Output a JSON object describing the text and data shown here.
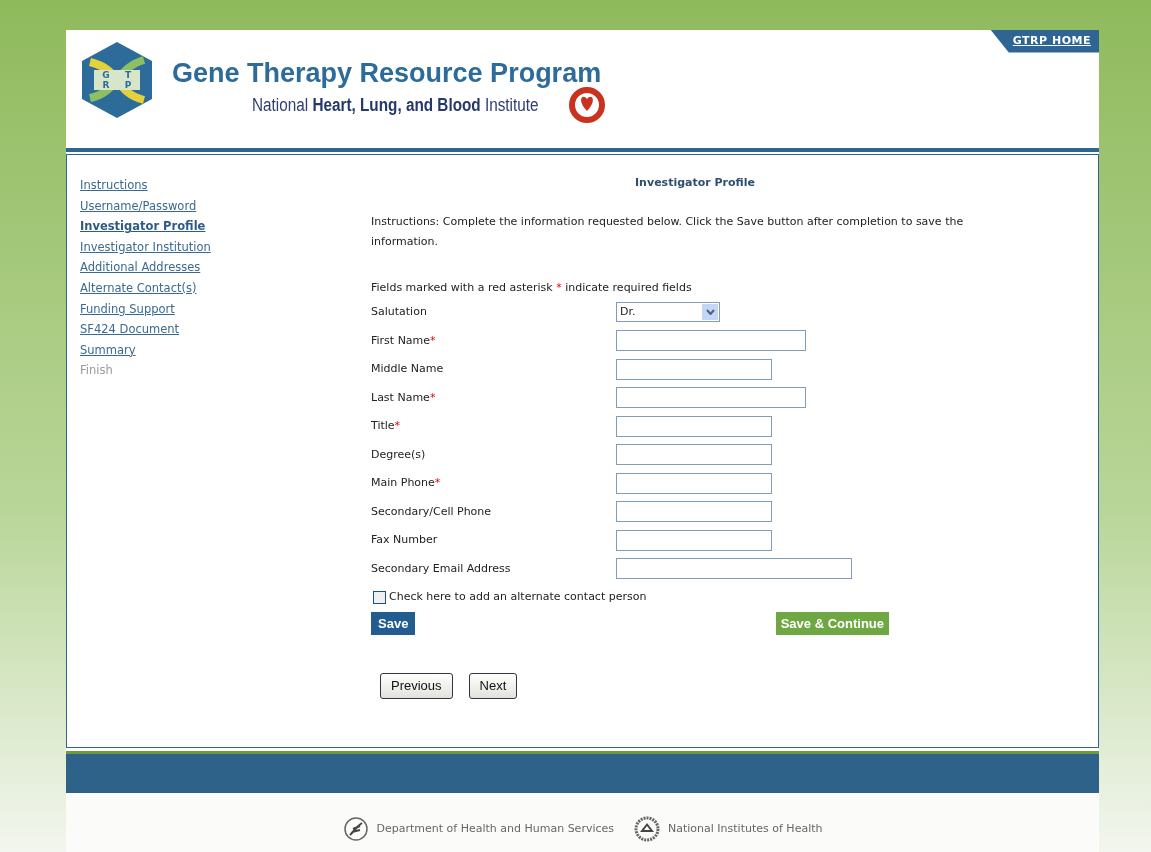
{
  "header": {
    "title": "Gene Therapy Resource Program",
    "subtitle": "National **Heart, Lung, and Blood** Institute",
    "logo_text": [
      "G",
      "T",
      "R",
      "P"
    ],
    "home_link": "GTRP HOME"
  },
  "sidebar": {
    "items": [
      {
        "label": "Instructions",
        "selected": false,
        "disabled": false
      },
      {
        "label": "Username/Password",
        "selected": false,
        "disabled": false
      },
      {
        "label": "Investigator Profile",
        "selected": true,
        "disabled": false
      },
      {
        "label": "Investigator Institution",
        "selected": false,
        "disabled": false
      },
      {
        "label": "Additional Addresses",
        "selected": false,
        "disabled": false
      },
      {
        "label": "Alternate Contact(s)",
        "selected": false,
        "disabled": false
      },
      {
        "label": "Funding Support",
        "selected": false,
        "disabled": false
      },
      {
        "label": "SF424 Document",
        "selected": false,
        "disabled": false
      },
      {
        "label": "Summary",
        "selected": false,
        "disabled": false
      },
      {
        "label": "Finish",
        "selected": false,
        "disabled": true
      }
    ]
  },
  "form": {
    "title": "Investigator Profile",
    "instructions": "Instructions: Complete the information requested below. Click the Save button after completion to save the information.",
    "required_note": {
      "before": "Fields marked with a red asterisk",
      "mark": "*",
      "after": "indicate required fields"
    },
    "fields": [
      {
        "kind": "select",
        "label": "Salutation",
        "required": false,
        "value": "Dr."
      },
      {
        "kind": "medium",
        "label": "First Name",
        "required": true
      },
      {
        "kind": "short",
        "label": "Middle Name",
        "required": false
      },
      {
        "kind": "medium",
        "label": "Last Name",
        "required": true
      },
      {
        "kind": "short",
        "label": "Title",
        "required": true
      },
      {
        "kind": "short",
        "label": "Degree(s)",
        "required": false
      },
      {
        "kind": "short",
        "label": "Main Phone",
        "required": true
      },
      {
        "kind": "short",
        "label": "Secondary/Cell Phone",
        "required": false
      },
      {
        "kind": "short",
        "label": "Fax Number",
        "required": false
      },
      {
        "kind": "long",
        "label": "Secondary Email Address",
        "required": false
      }
    ],
    "checkbox": {
      "label": "Check here to add an alternate contact person",
      "checked": false
    },
    "save_button": "Save",
    "save_continue_button": "Save & Continue",
    "nav_buttons": [
      "Previous",
      "Next"
    ]
  },
  "footer": {
    "links": [
      "Department of Health and Human Services",
      "National Institutes of Health"
    ]
  }
}
